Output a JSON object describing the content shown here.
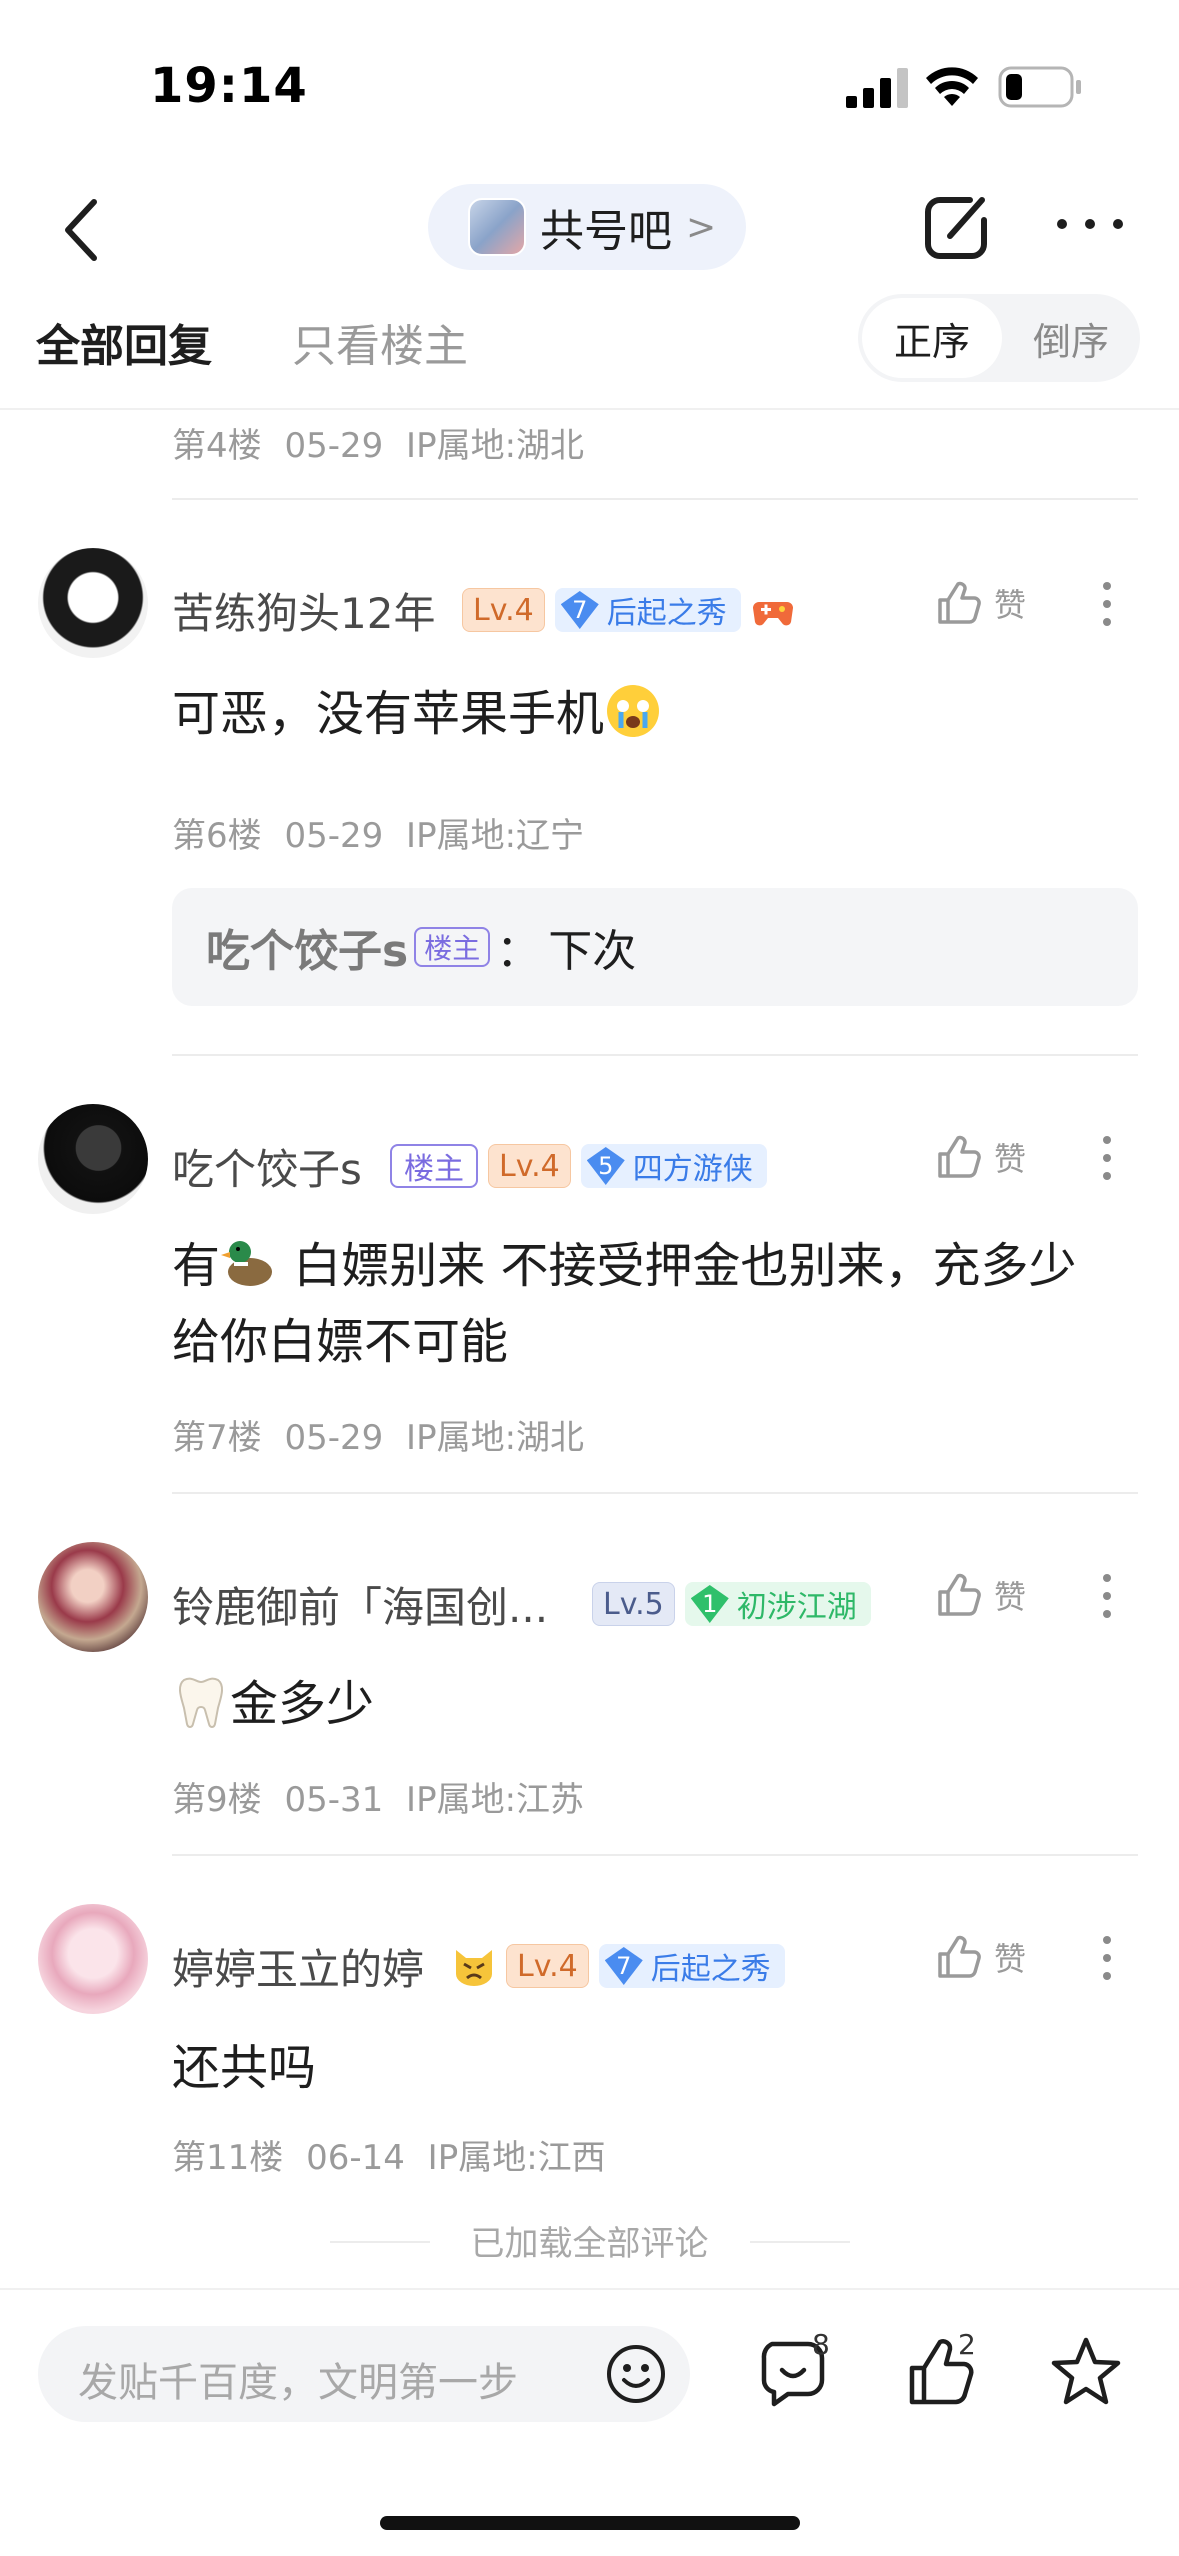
{
  "status": {
    "time": "19:14"
  },
  "nav": {
    "forum_name": "共号吧",
    "chevron": ">"
  },
  "tabs": {
    "all": "全部回复",
    "op_only": "只看楼主",
    "asc": "正序",
    "desc": "倒序"
  },
  "top_meta": "第4楼 05-29 IP属地:湖北",
  "posts": [
    {
      "username": "苦练狗头12年",
      "level": "Lv.4",
      "title_num": "7",
      "title": "后起之秀",
      "content": "可恶，没有苹果手机",
      "meta": "第6楼 05-29 IP属地:辽宁",
      "like": "赞",
      "reply": {
        "user": "吃个饺子s",
        "op_tag": "楼主",
        "colon": "：",
        "text": "下次"
      }
    },
    {
      "username": "吃个饺子s",
      "op_tag": "楼主",
      "level": "Lv.4",
      "title_num": "5",
      "title": "四方游侠",
      "content_1": "有",
      "content_2": " 白嫖别来 不接受押金也别来，充多少给你白嫖不可能",
      "meta": "第7楼 05-29 IP属地:湖北",
      "like": "赞"
    },
    {
      "username": "铃鹿御前「海国创...",
      "level": "Lv.5",
      "title_num": "1",
      "title": "初涉江湖",
      "content": "金多少",
      "meta": "第9楼 05-31 IP属地:江苏",
      "like": "赞"
    },
    {
      "username": "婷婷玉立的婷",
      "level": "Lv.4",
      "title_num": "7",
      "title": "后起之秀",
      "content": "还共吗",
      "meta": "第11楼 06-14 IP属地:江西",
      "like": "赞"
    }
  ],
  "loaded_text": "已加载全部评论",
  "bottom": {
    "placeholder": "发贴千百度，文明第一步",
    "comment_count": "8",
    "like_count": "2"
  },
  "colors": {
    "accent_blue": "#3a7ce8",
    "op_purple": "#7a6ce0",
    "level_orange": "#d06a2a"
  }
}
